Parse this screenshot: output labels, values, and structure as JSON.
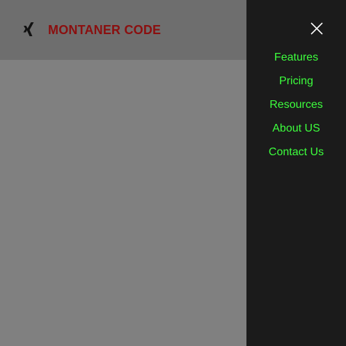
{
  "header": {
    "logo_icon": "xing-logo-icon",
    "brand": "MONTANER CODE",
    "brand_color": "#8b0f0f"
  },
  "drawer": {
    "close_icon": "close-icon",
    "link_color": "#3dff3d",
    "items": [
      {
        "label": "Features"
      },
      {
        "label": "Pricing"
      },
      {
        "label": "Resources"
      },
      {
        "label": "About US"
      },
      {
        "label": "Contact Us"
      }
    ]
  }
}
